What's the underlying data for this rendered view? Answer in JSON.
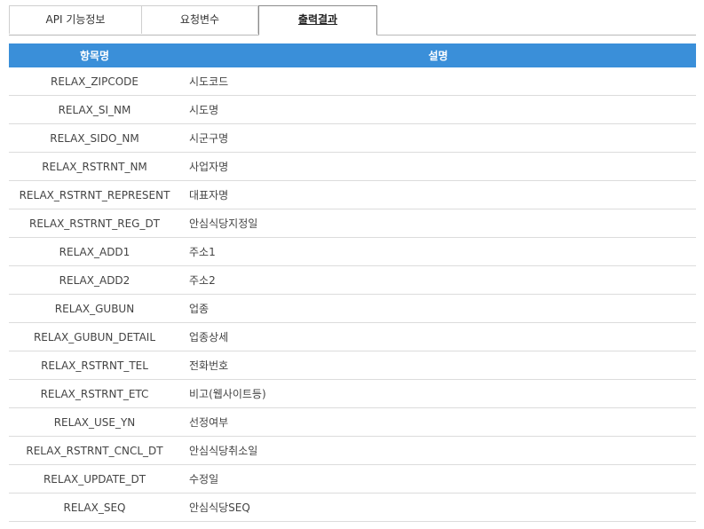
{
  "tabs": [
    {
      "label": "API 기능정보",
      "active": false
    },
    {
      "label": "요청변수",
      "active": false
    },
    {
      "label": "출력결과",
      "active": true
    }
  ],
  "table": {
    "headers": [
      "항목명",
      "설명"
    ],
    "rows": [
      [
        "RELAX_ZIPCODE",
        "시도코드"
      ],
      [
        "RELAX_SI_NM",
        "시도명"
      ],
      [
        "RELAX_SIDO_NM",
        "시군구명"
      ],
      [
        "RELAX_RSTRNT_NM",
        "사업자명"
      ],
      [
        "RELAX_RSTRNT_REPRESENT",
        "대표자명"
      ],
      [
        "RELAX_RSTRNT_REG_DT",
        "안심식당지정일"
      ],
      [
        "RELAX_ADD1",
        "주소1"
      ],
      [
        "RELAX_ADD2",
        "주소2"
      ],
      [
        "RELAX_GUBUN",
        "업종"
      ],
      [
        "RELAX_GUBUN_DETAIL",
        "업종상세"
      ],
      [
        "RELAX_RSTRNT_TEL",
        "전화번호"
      ],
      [
        "RELAX_RSTRNT_ETC",
        "비고(웹사이트등)"
      ],
      [
        "RELAX_USE_YN",
        "선정여부"
      ],
      [
        "RELAX_RSTRNT_CNCL_DT",
        "안심식당취소일"
      ],
      [
        "RELAX_UPDATE_DT",
        "수정일"
      ],
      [
        "RELAX_SEQ",
        "안심식당SEQ"
      ]
    ]
  },
  "colors": {
    "header_bg": "#3a8fd9",
    "header_text": "#ffffff",
    "row_border": "#dcdcdc"
  }
}
